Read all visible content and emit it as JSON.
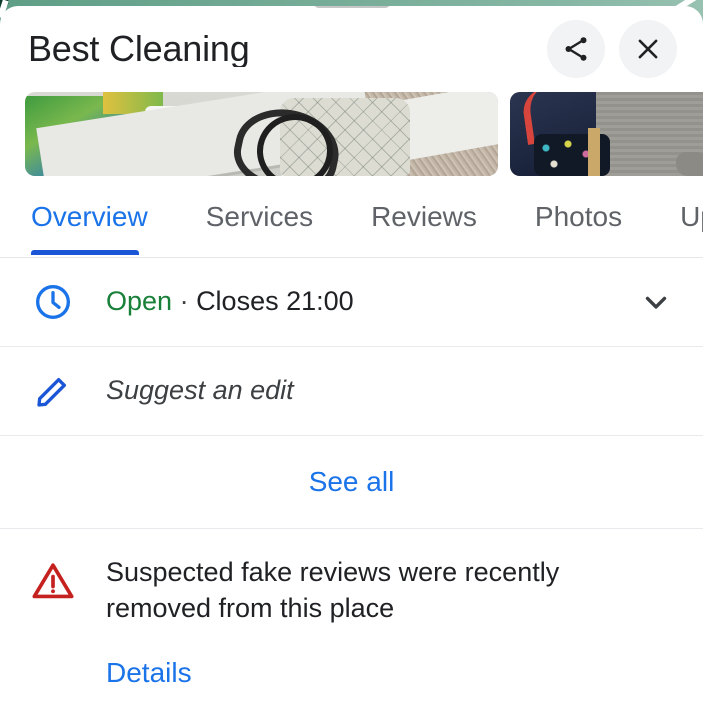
{
  "sheet": {
    "drag_handle": "drag-handle",
    "title": "Best Cleaning"
  },
  "header": {
    "share_icon": "share-icon",
    "share_label": "Share",
    "close_icon": "close-icon",
    "close_label": "Close"
  },
  "photos": {
    "count": 2,
    "items": [
      {
        "alt": "Ironing board with laundry and a patterned bag on tiled floor"
      },
      {
        "alt": "Dark blue bedding and carpet corner"
      }
    ]
  },
  "tabs": {
    "active": "Overview",
    "items": [
      {
        "label": "Overview",
        "active": true
      },
      {
        "label": "Services",
        "active": false
      },
      {
        "label": "Reviews",
        "active": false
      },
      {
        "label": "Photos",
        "active": false
      },
      {
        "label": "Upd",
        "active": false
      }
    ]
  },
  "hours": {
    "icon": "clock-icon",
    "status": "Open",
    "separator": " · ",
    "detail": "Closes 21:00",
    "expand_icon": "chevron-down-icon"
  },
  "suggest_edit": {
    "icon": "pencil-icon",
    "label": "Suggest an edit"
  },
  "see_all": {
    "label": "See all"
  },
  "warning": {
    "icon": "warning-triangle-icon",
    "message": "Suspected fake reviews were recently removed from this place",
    "link_label": "Details"
  },
  "colors": {
    "accent_blue": "#1a73e8",
    "tab_indicator_blue": "#1a56d6",
    "open_green": "#188038",
    "warning_red": "#c5221f",
    "text_primary": "#202124",
    "text_secondary": "#5f6368",
    "divider": "#e8eaed",
    "chip_bg": "#f1f3f4",
    "handle_gray": "#c4c7c5"
  }
}
